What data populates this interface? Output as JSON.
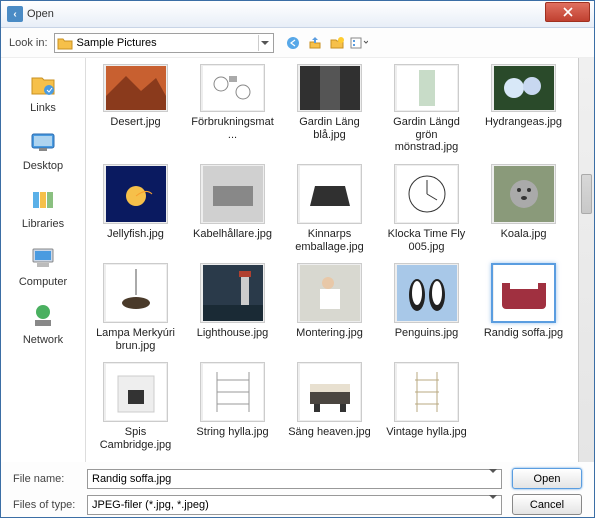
{
  "window": {
    "title": "Open"
  },
  "toolbar": {
    "lookin_label": "Look in:",
    "lookin_value": "Sample Pictures",
    "icons": [
      "back-icon",
      "up-icon",
      "new-folder-icon",
      "views-icon"
    ]
  },
  "sidebar": {
    "items": [
      {
        "label": "Links"
      },
      {
        "label": "Desktop"
      },
      {
        "label": "Libraries"
      },
      {
        "label": "Computer"
      },
      {
        "label": "Network"
      }
    ]
  },
  "files": [
    [
      {
        "name": "Desert.jpg"
      },
      {
        "name": "Förbrukningsmat..."
      },
      {
        "name": "Gardin Läng blå.jpg"
      },
      {
        "name": "Gardin Längd grön mönstrad.jpg"
      },
      {
        "name": "Hydrangeas.jpg"
      }
    ],
    [
      {
        "name": "Jellyfish.jpg"
      },
      {
        "name": "Kabelhållare.jpg"
      },
      {
        "name": "Kinnarps emballage.jpg"
      },
      {
        "name": "Klocka Time Fly 005.jpg"
      },
      {
        "name": "Koala.jpg"
      }
    ],
    [
      {
        "name": "Lampa Merkyúri brun.jpg"
      },
      {
        "name": "Lighthouse.jpg"
      },
      {
        "name": "Montering.jpg"
      },
      {
        "name": "Penguins.jpg"
      },
      {
        "name": "Randig soffa.jpg",
        "selected": true
      }
    ],
    [
      {
        "name": "Spis Cambridge.jpg"
      },
      {
        "name": "String hylla.jpg"
      },
      {
        "name": "Säng heaven.jpg"
      },
      {
        "name": "Vintage hylla.jpg"
      }
    ]
  ],
  "footer": {
    "filename_label": "File name:",
    "filename_value": "Randig soffa.jpg",
    "filetype_label": "Files of type:",
    "filetype_value": "JPEG-filer (*.jpg, *.jpeg)",
    "open_label": "Open",
    "cancel_label": "Cancel"
  }
}
